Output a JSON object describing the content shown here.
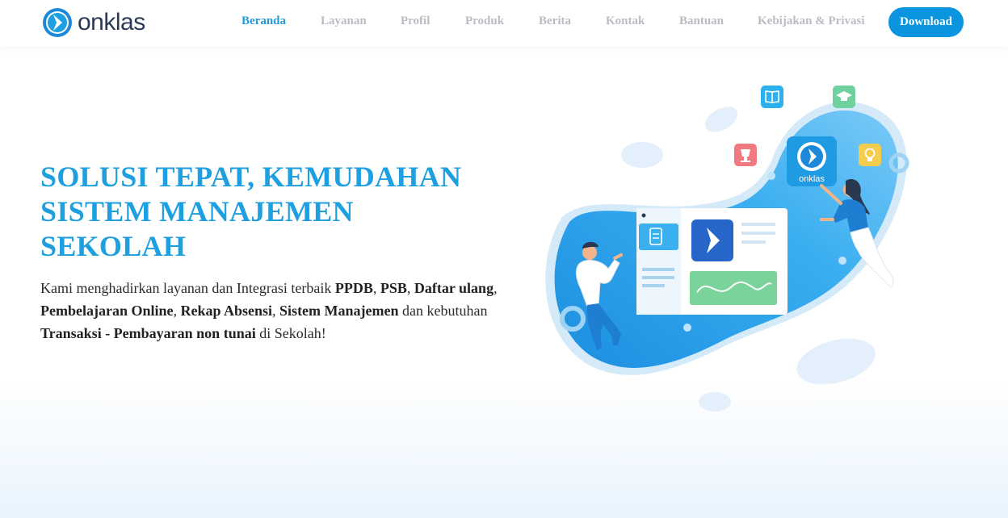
{
  "brand": {
    "name": "onklas",
    "accent": "#1e9fe0",
    "button_color": "#0a95de"
  },
  "nav": {
    "items": [
      {
        "label": "Beranda",
        "active": true
      },
      {
        "label": "Layanan",
        "active": false
      },
      {
        "label": "Profil",
        "active": false
      },
      {
        "label": "Produk",
        "active": false
      },
      {
        "label": "Berita",
        "active": false
      },
      {
        "label": "Kontak",
        "active": false
      },
      {
        "label": "Bantuan",
        "active": false
      },
      {
        "label": "Kebijakan & Privasi",
        "active": false
      }
    ],
    "download_label": "Download"
  },
  "hero": {
    "title_lines": [
      "SOLUSI TEPAT, KEMUDAHAN",
      "SISTEM MANAJEMEN",
      "SEKOLAH"
    ],
    "desc": {
      "t1": "Kami menghadirkan layanan dan Integrasi terbaik ",
      "b1": "PPDB",
      "t2": ", ",
      "b2": "PSB",
      "t3": ", ",
      "b3": "Daftar ulang",
      "t4": ", ",
      "b4": "Pembelajaran Online",
      "t5": ", ",
      "b5": "Rekap Absensi",
      "t6": ", ",
      "b6": "Sistem Manajemen",
      "t7": " dan kebutuhan ",
      "b7": "Transaksi - Pembayaran non tunai",
      "t8": " di Sekolah!"
    }
  },
  "illustration": {
    "app_label": "onklas",
    "icons": [
      "book-icon",
      "graduation-cap-icon",
      "trophy-icon",
      "lightbulb-icon",
      "clipboard-icon"
    ]
  }
}
